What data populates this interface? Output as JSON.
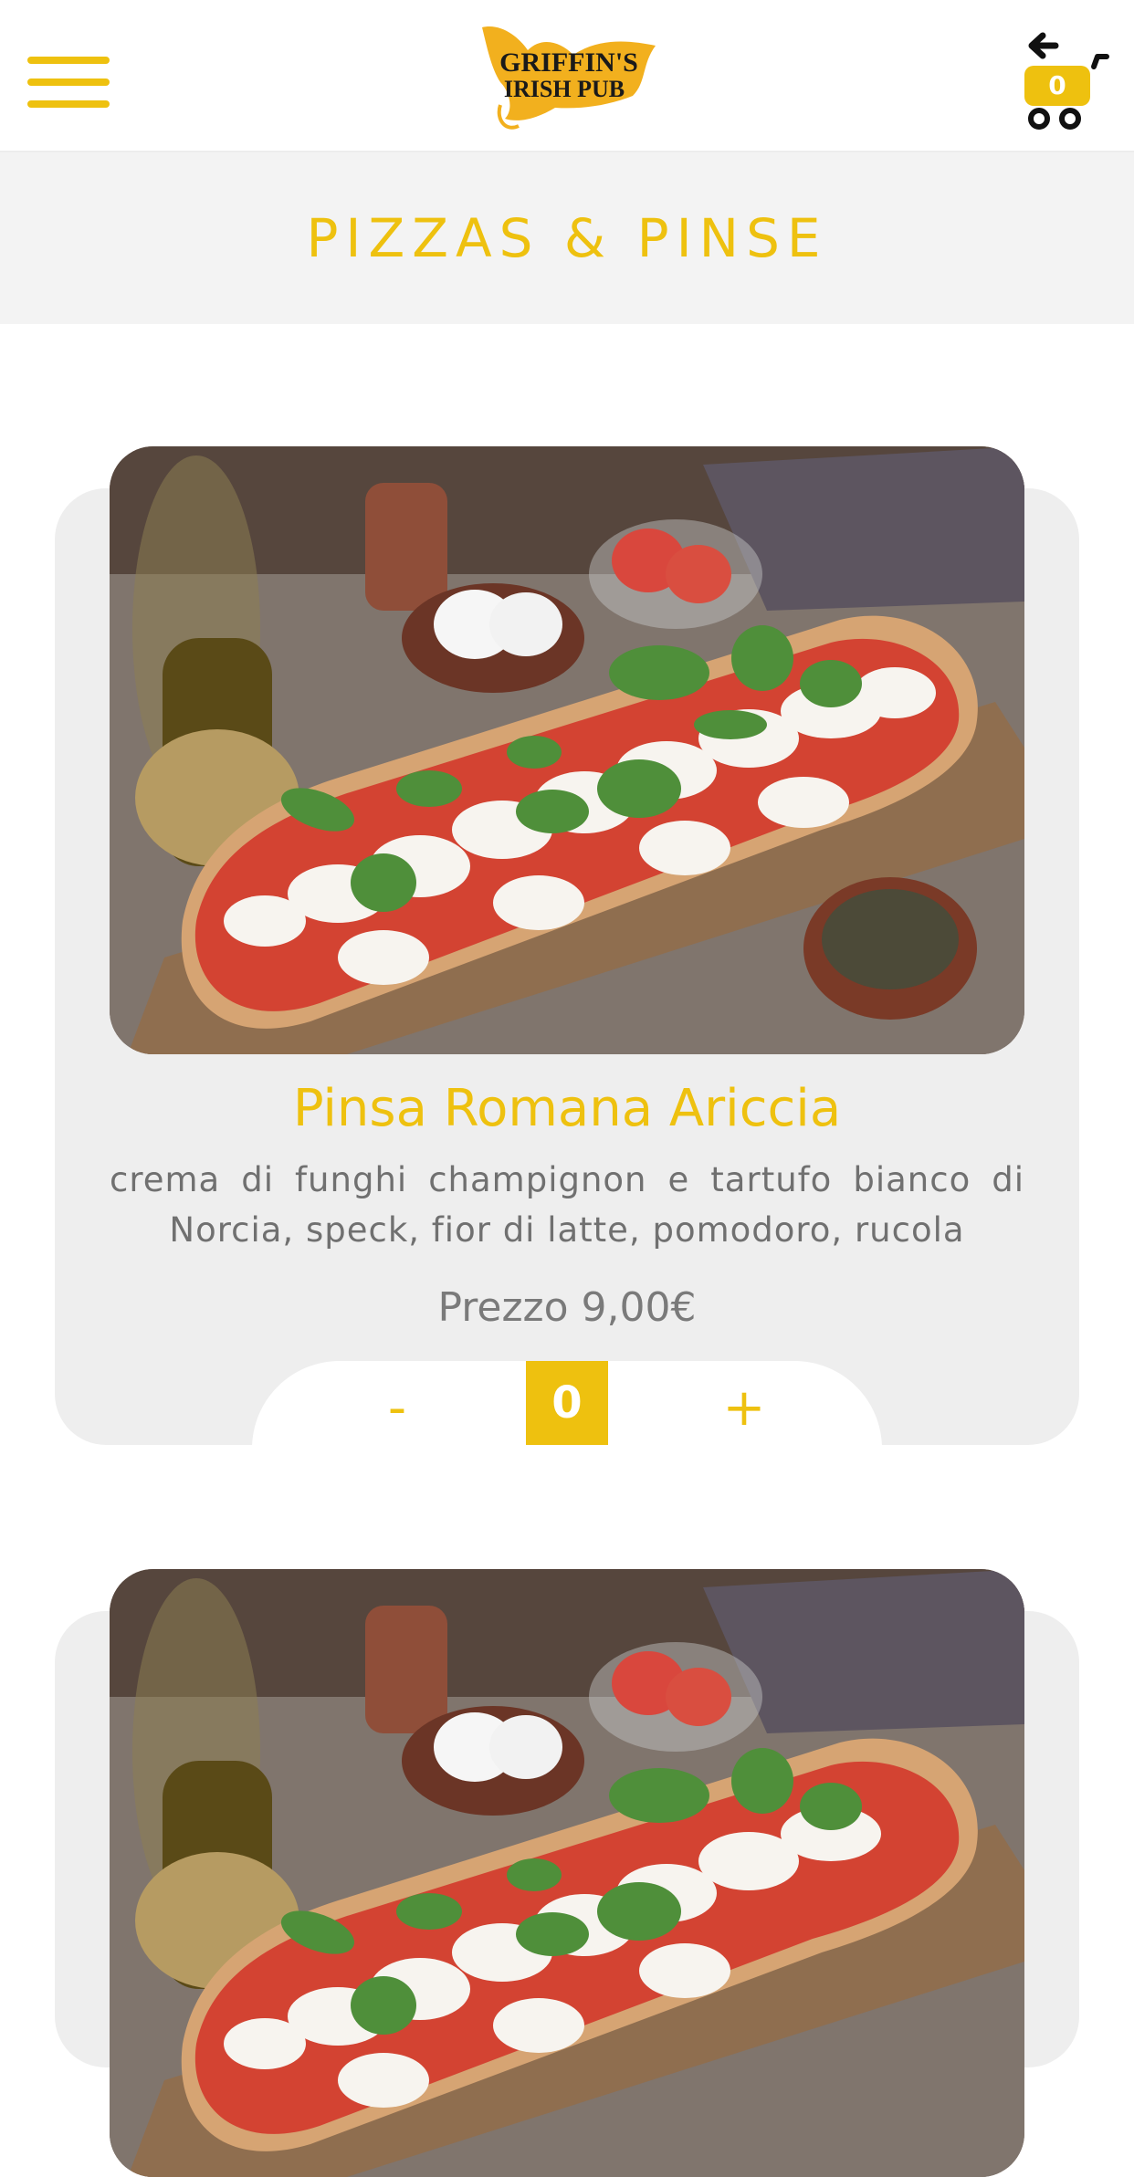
{
  "header": {
    "menu_icon": "hamburger-menu-icon",
    "logo_line1": "GRIFFIN'S",
    "logo_line2": "IRISH PUB",
    "cart_icon": "cart-icon",
    "cart_count": "0",
    "accent_color": "#eec10f"
  },
  "section": {
    "title": "PIZZAS & PINSE"
  },
  "products": [
    {
      "name": "Pinsa Romana Ariccia",
      "description": "crema di funghi champignon e tartufo bianco di Norcia, speck, fior di latte, pomodoro, rucola",
      "price": "Prezzo 9,00€",
      "quantity": {
        "minus_label": "-",
        "value": "0",
        "plus_label": "+"
      }
    }
  ]
}
